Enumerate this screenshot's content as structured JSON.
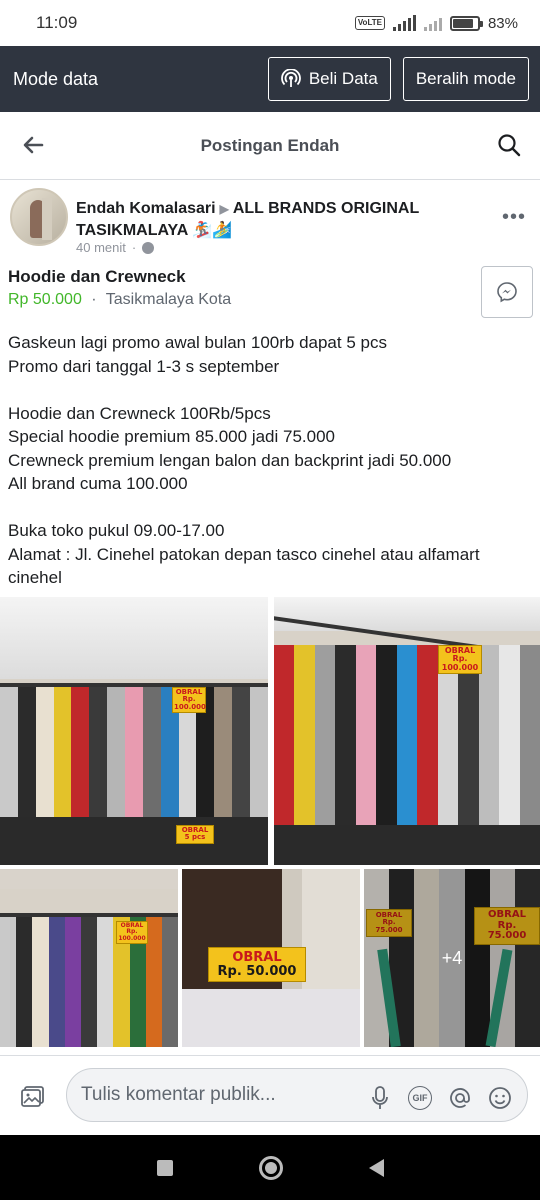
{
  "status_bar": {
    "time": "11:09",
    "battery": "83%",
    "battery_level": 0.83,
    "volte": "Vo LTE",
    "network": "4G+"
  },
  "mode_bar": {
    "label": "Mode data",
    "buy_button": "Beli Data",
    "switch_button": "Beralih mode"
  },
  "title_bar": {
    "title": "Postingan Endah"
  },
  "post": {
    "author": "Endah Komalasari",
    "group": "ALL BRANDS ORIGINAL TASIKMALAYA 🏂🏄",
    "time": "40 menit",
    "product_title": "Hoodie dan Crewneck",
    "price": "Rp 50.000",
    "separator": "·",
    "location": "Tasikmalaya Kota",
    "body_lines": [
      "Gaskeun lagi promo awal bulan 100rb dapat 5 pcs",
      "Promo dari tanggal 1-3 s september",
      "",
      "Hoodie dan Crewneck 100Rb/5pcs",
      "Special hoodie premium 85.000 jadi 75.000",
      "Crewneck premium lengan balon dan backprint jadi 50.000",
      "All brand cuma 100.000",
      "",
      "Buka toko pukul 09.00-17.00",
      "Alamat : Jl. Cinehel patokan depan tasco cinehel atau alfamart cinehel"
    ],
    "photo_tags": {
      "obral": "OBRAL",
      "p1_tag": "Rp. 100.000",
      "p1_sub": "5 pcs",
      "p4_price": "Rp. 50.000",
      "p5_price": "Rp. 75.000",
      "more_count": "+4"
    }
  },
  "comment_bar": {
    "placeholder": "Tulis komentar publik..."
  },
  "icons": [
    "back-arrow-icon",
    "search-icon",
    "more-icon",
    "messenger-icon",
    "photo-icon",
    "mic-icon",
    "gif-icon",
    "mention-icon",
    "emoji-icon",
    "globe-icon",
    "broadcast-icon"
  ]
}
